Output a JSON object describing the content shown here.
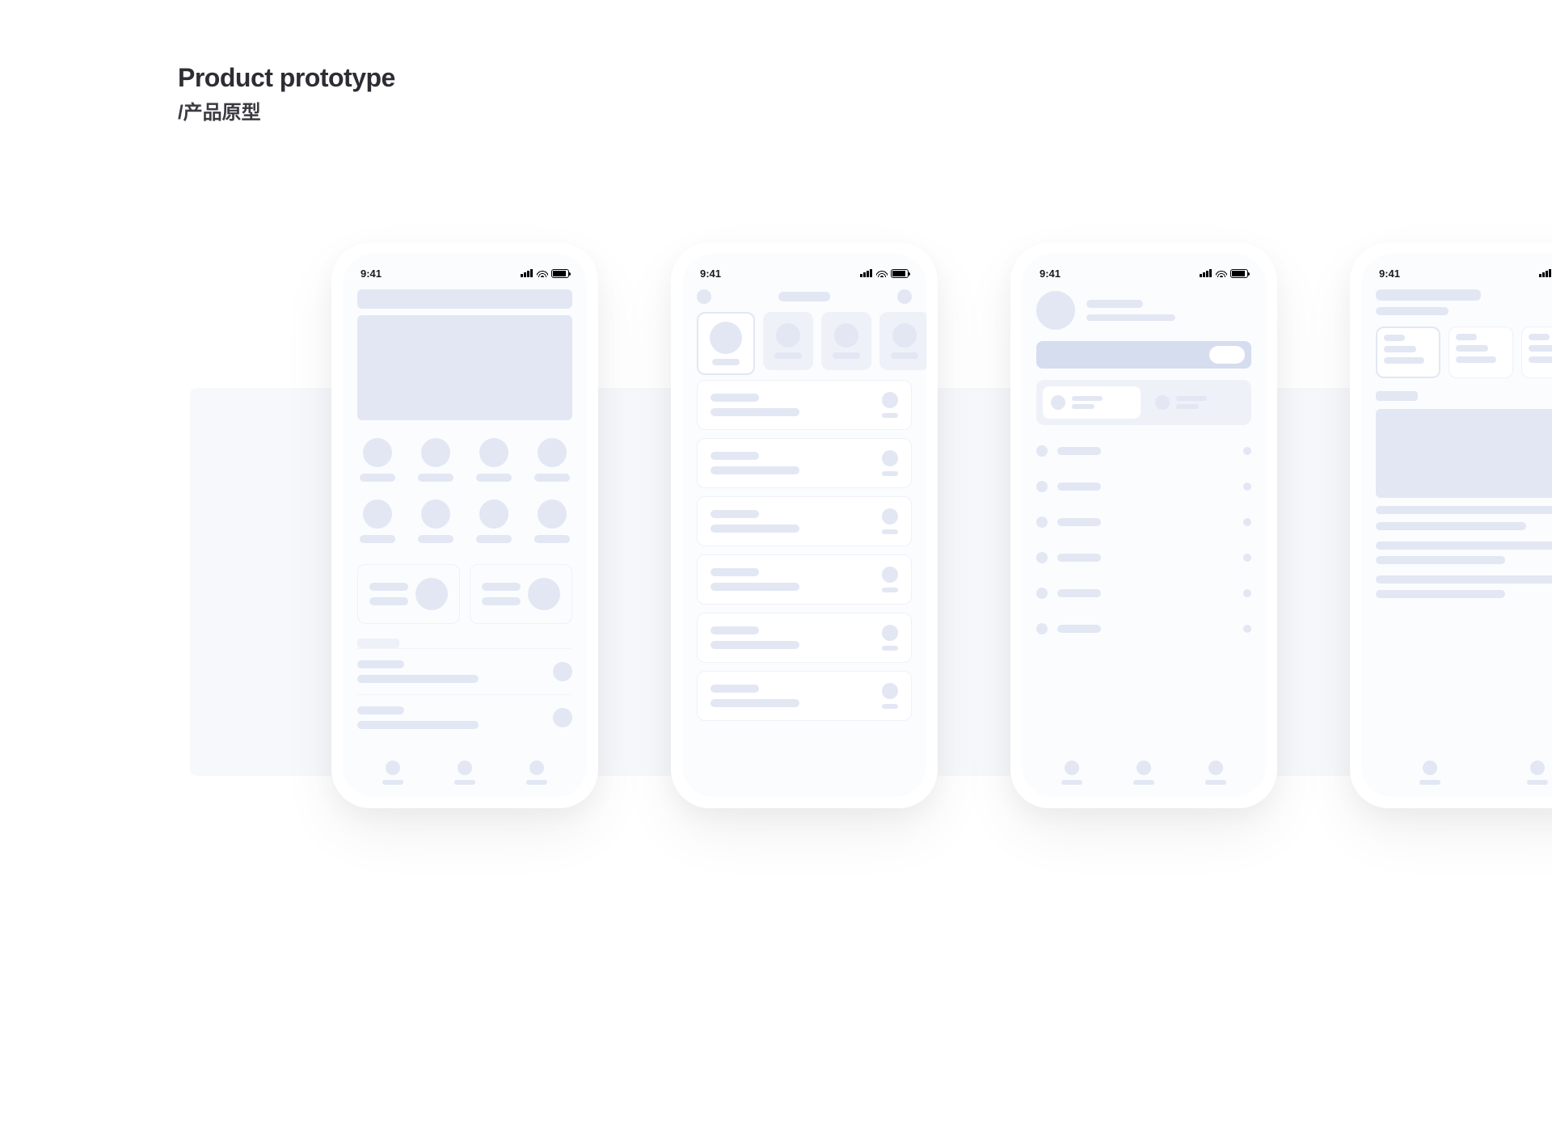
{
  "header": {
    "title": "Product prototype",
    "subtitle_slash": "/",
    "subtitle": "产品原型"
  },
  "status": {
    "time": "9:41"
  },
  "icons": {
    "signal": "signal-icon",
    "wifi": "wifi-icon",
    "battery": "battery-icon"
  },
  "wireframe_note": "Low-fidelity wireframe mockups; body content consists of placeholder shapes with no readable text.",
  "phones": {
    "count": 4,
    "layouts": [
      "home-grid-with-hero",
      "stories-and-list",
      "profile-settings",
      "content-detail"
    ]
  },
  "colors": {
    "placeholder": "#e2e7f3",
    "placeholder_light": "#eef1f8",
    "banner": "#d6ddee",
    "text": "#2d2d34",
    "page_bg": "#ffffff",
    "stage_bg": "#f6f8fb"
  }
}
